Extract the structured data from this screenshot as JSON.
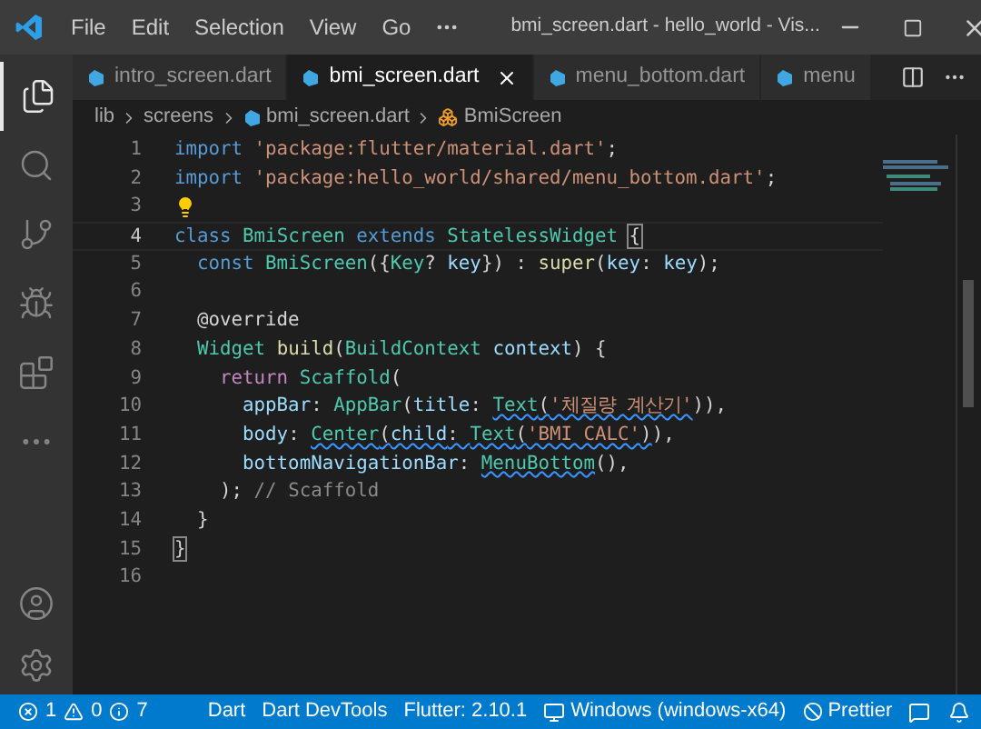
{
  "window": {
    "title": "bmi_screen.dart - hello_world - Vis..."
  },
  "menu": [
    {
      "label": "File"
    },
    {
      "label": "Edit"
    },
    {
      "label": "Selection"
    },
    {
      "label": "View"
    },
    {
      "label": "Go"
    }
  ],
  "activity_bar": [
    {
      "kind": "files",
      "selected": true
    },
    {
      "kind": "search",
      "selected": false
    },
    {
      "kind": "branch",
      "selected": false
    },
    {
      "kind": "debug",
      "selected": false
    },
    {
      "kind": "extensions",
      "selected": false
    },
    {
      "kind": "more",
      "selected": false
    }
  ],
  "tabs": [
    {
      "label": "intro_screen.dart",
      "selected": false
    },
    {
      "label": "bmi_screen.dart",
      "selected": true
    },
    {
      "label": "menu_bottom.dart",
      "selected": false
    },
    {
      "label": "menu",
      "selected": false
    }
  ],
  "breadcrumb": [
    {
      "label": "lib",
      "kind": "folder"
    },
    {
      "label": "screens",
      "kind": "folder"
    },
    {
      "label": "bmi_screen.dart",
      "kind": "file"
    },
    {
      "label": "BmiScreen",
      "kind": "class"
    }
  ],
  "code": [
    {
      "number": "1",
      "current": false,
      "lightbulb": false,
      "tokens": [
        {
          "t": "import ",
          "kind": "keyword"
        },
        {
          "t": "'package:flutter/material.dart'",
          "kind": "string"
        },
        {
          "t": ";",
          "kind": "plain"
        }
      ]
    },
    {
      "number": "2",
      "current": false,
      "lightbulb": false,
      "tokens": [
        {
          "t": "import ",
          "kind": "keyword"
        },
        {
          "t": "'package:hello_world/shared/menu_bottom.dart'",
          "kind": "string"
        },
        {
          "t": ";",
          "kind": "plain"
        }
      ]
    },
    {
      "number": "3",
      "current": false,
      "lightbulb": true
    },
    {
      "number": "4",
      "current": true,
      "lightbulb": false,
      "tokens": [
        {
          "t": "class ",
          "kind": "keyword"
        },
        {
          "t": "BmiScreen ",
          "kind": "type"
        },
        {
          "t": "extends ",
          "kind": "keyword"
        },
        {
          "t": "StatelessWidget ",
          "kind": "type"
        },
        {
          "t": "{",
          "kind": "plain",
          "matched": true
        }
      ]
    },
    {
      "number": "5",
      "current": false,
      "lightbulb": false,
      "tokens": [
        {
          "t": "  const ",
          "kind": "keyword"
        },
        {
          "t": "BmiScreen",
          "kind": "type"
        },
        {
          "t": "({",
          "kind": "plain"
        },
        {
          "t": "Key",
          "kind": "type"
        },
        {
          "t": "? ",
          "kind": "plain"
        },
        {
          "t": "key",
          "kind": "var"
        },
        {
          "t": "}) : ",
          "kind": "plain"
        },
        {
          "t": "super",
          "kind": "func"
        },
        {
          "t": "(",
          "kind": "plain"
        },
        {
          "t": "key",
          "kind": "var"
        },
        {
          "t": ": ",
          "kind": "plain"
        },
        {
          "t": "key",
          "kind": "var"
        },
        {
          "t": ");",
          "kind": "plain"
        }
      ]
    },
    {
      "number": "6",
      "current": false,
      "lightbulb": false
    },
    {
      "number": "7",
      "current": false,
      "lightbulb": false,
      "tokens": [
        {
          "t": "  @override",
          "kind": "plain"
        }
      ]
    },
    {
      "number": "8",
      "current": false,
      "lightbulb": false,
      "tokens": [
        {
          "t": "  Widget ",
          "kind": "type"
        },
        {
          "t": "build",
          "kind": "func"
        },
        {
          "t": "(",
          "kind": "plain"
        },
        {
          "t": "BuildContext ",
          "kind": "type"
        },
        {
          "t": "context",
          "kind": "var"
        },
        {
          "t": ") {",
          "kind": "plain"
        }
      ]
    },
    {
      "number": "9",
      "current": false,
      "lightbulb": false,
      "tokens": [
        {
          "t": "    return ",
          "kind": "control"
        },
        {
          "t": "Scaffold",
          "kind": "type"
        },
        {
          "t": "(",
          "kind": "plain"
        }
      ]
    },
    {
      "number": "10",
      "current": false,
      "lightbulb": false,
      "tokens": [
        {
          "t": "      appBar",
          "kind": "var"
        },
        {
          "t": ": ",
          "kind": "plain"
        },
        {
          "t": "AppBar",
          "kind": "type"
        },
        {
          "t": "(",
          "kind": "plain"
        },
        {
          "t": "title",
          "kind": "var"
        },
        {
          "t": ": ",
          "kind": "plain"
        },
        {
          "t": "Text",
          "kind": "type",
          "squiggle": true
        },
        {
          "t": "(",
          "kind": "plain",
          "squiggle": true
        },
        {
          "t": "'체질량 계산기'",
          "kind": "string",
          "squiggle": true
        },
        {
          "t": ")),",
          "kind": "plain"
        }
      ]
    },
    {
      "number": "11",
      "current": false,
      "lightbulb": false,
      "tokens": [
        {
          "t": "      body",
          "kind": "var"
        },
        {
          "t": ": ",
          "kind": "plain"
        },
        {
          "t": "Center",
          "kind": "type",
          "squiggle": true
        },
        {
          "t": "(",
          "kind": "plain",
          "squiggle": true
        },
        {
          "t": "child",
          "kind": "var",
          "squiggle": true
        },
        {
          "t": ": ",
          "kind": "plain",
          "squiggle": true
        },
        {
          "t": "Text",
          "kind": "type",
          "squiggle": true
        },
        {
          "t": "(",
          "kind": "plain",
          "squiggle": true
        },
        {
          "t": "'BMI CALC'",
          "kind": "string",
          "squiggle": true
        },
        {
          "t": ")",
          "kind": "plain",
          "squiggle": true
        },
        {
          "t": "),",
          "kind": "plain"
        }
      ]
    },
    {
      "number": "12",
      "current": false,
      "lightbulb": false,
      "tokens": [
        {
          "t": "      bottomNavigationBar",
          "kind": "var"
        },
        {
          "t": ": ",
          "kind": "plain"
        },
        {
          "t": "MenuBottom",
          "kind": "type",
          "squiggle": true
        },
        {
          "t": "(),",
          "kind": "plain"
        }
      ]
    },
    {
      "number": "13",
      "current": false,
      "lightbulb": false,
      "tokens": [
        {
          "t": "    ); ",
          "kind": "plain"
        },
        {
          "t": "// Scaffold",
          "kind": "label"
        }
      ]
    },
    {
      "number": "14",
      "current": false,
      "lightbulb": false,
      "tokens": [
        {
          "t": "  }",
          "kind": "plain"
        }
      ]
    },
    {
      "number": "15",
      "current": false,
      "lightbulb": false,
      "tokens": [
        {
          "t": "}",
          "kind": "plain",
          "matched": true
        }
      ]
    },
    {
      "number": "16",
      "current": false,
      "lightbulb": false
    }
  ],
  "status_bar": [
    {
      "kind": "problems",
      "items": [
        {
          "kind": "error",
          "count": "1"
        },
        {
          "kind": "warning",
          "count": "0"
        },
        {
          "kind": "info",
          "count": "7"
        }
      ]
    },
    {
      "kind": "text",
      "label": "Dart"
    },
    {
      "kind": "text",
      "label": "Dart DevTools"
    },
    {
      "kind": "text",
      "label": "Flutter: 2.10.1"
    },
    {
      "kind": "device",
      "label": "Windows (windows-x64)"
    },
    {
      "kind": "prettier",
      "label": "Prettier"
    }
  ]
}
